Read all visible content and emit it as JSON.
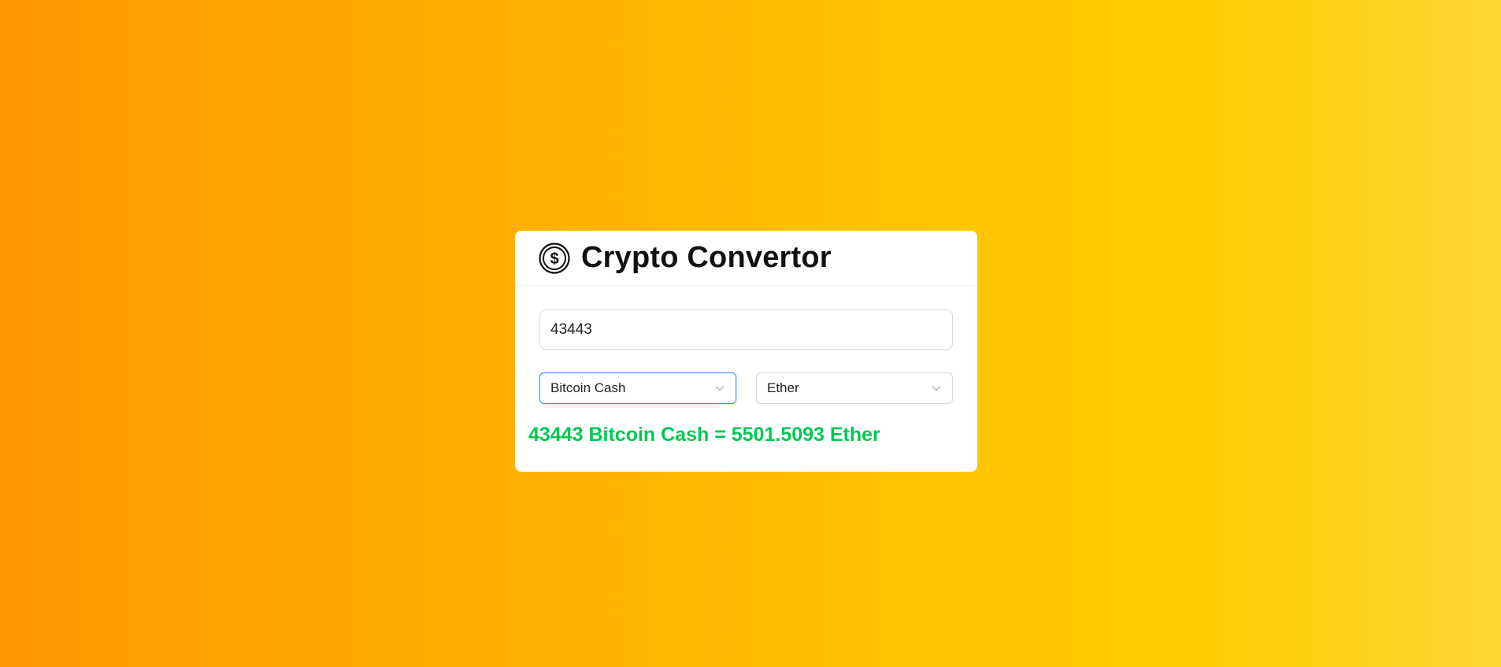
{
  "header": {
    "icon": "dollar-coin-icon",
    "title": "Crypto Convertor"
  },
  "converter": {
    "amount_value": "43443",
    "from_currency": "Bitcoin Cash",
    "to_currency": "Ether",
    "result_text": "43443 Bitcoin Cash = 5501.5093 Ether"
  },
  "colors": {
    "gradient_start": "#ff9800",
    "gradient_end": "#ffd633",
    "result_green": "#00c853",
    "focus_blue": "#4096ff"
  }
}
